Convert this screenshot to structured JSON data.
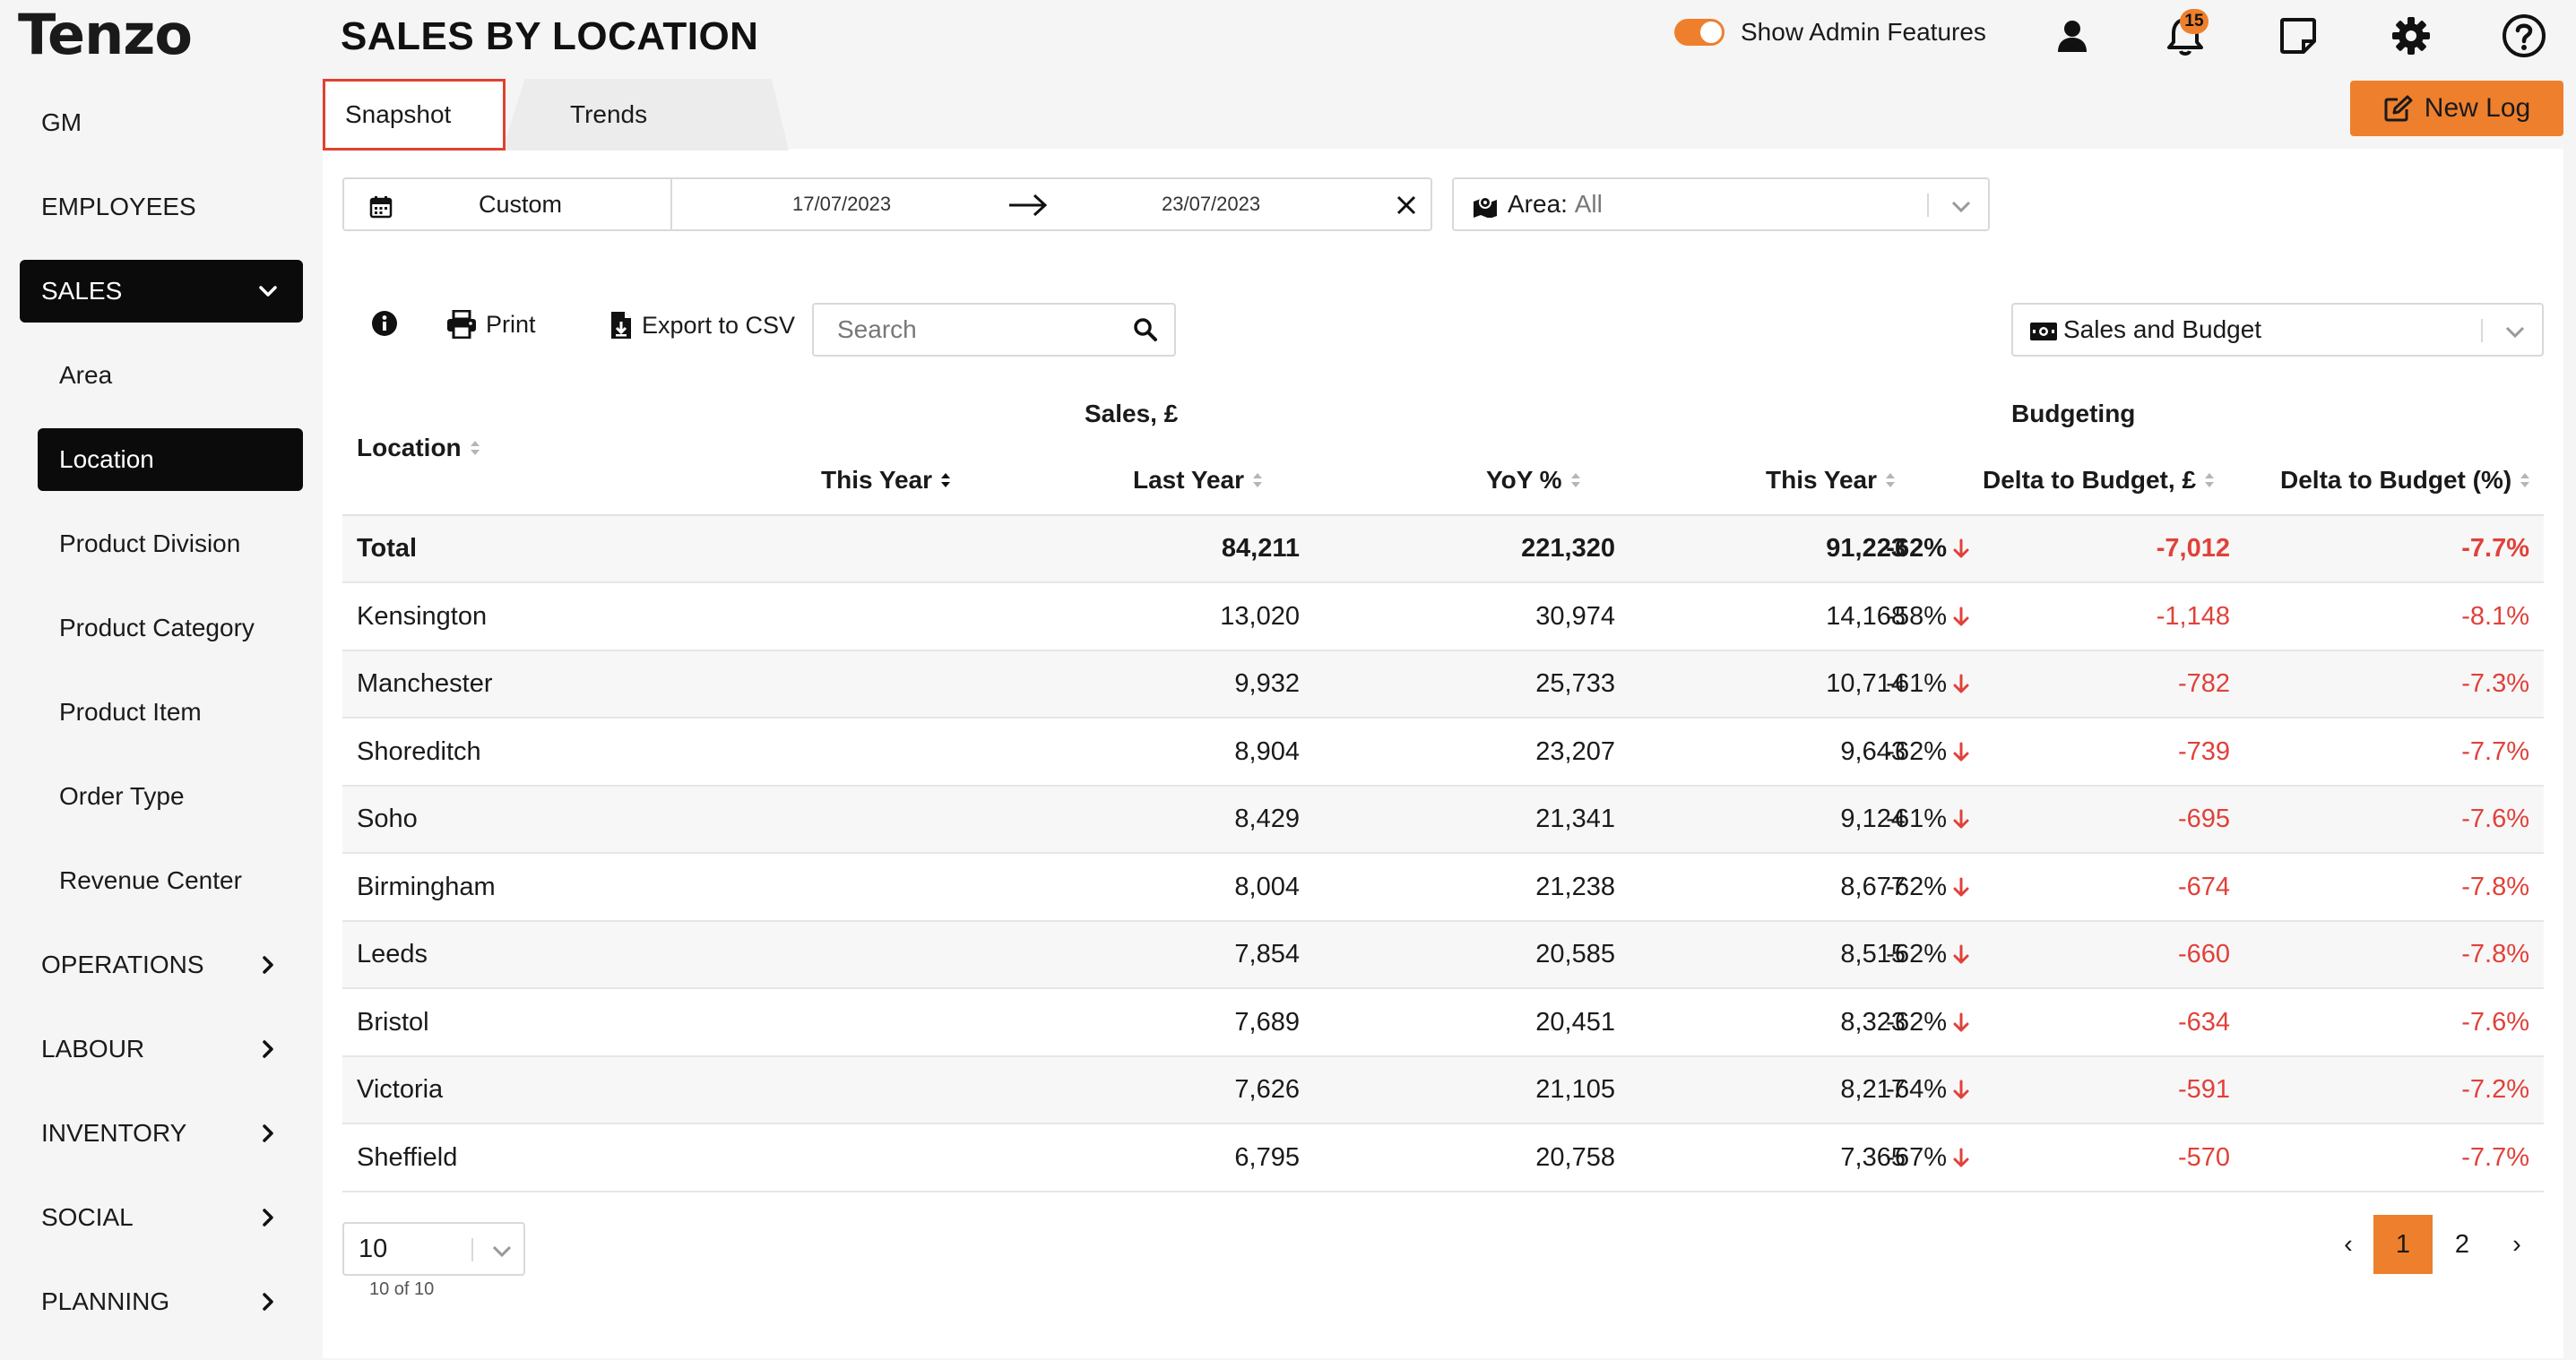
{
  "app": {
    "logo": "Tenzo"
  },
  "header": {
    "title": "SALES BY LOCATION",
    "admin_toggle_label": "Show Admin Features",
    "admin_toggle_on": true,
    "notification_count": "15",
    "new_log_label": "New Log"
  },
  "sidebar": {
    "items": [
      {
        "label": "GM"
      },
      {
        "label": "EMPLOYEES"
      },
      {
        "label": "SALES",
        "expanded": true
      },
      {
        "label": "OPERATIONS"
      },
      {
        "label": "LABOUR"
      },
      {
        "label": "INVENTORY"
      },
      {
        "label": "SOCIAL"
      },
      {
        "label": "PLANNING"
      }
    ],
    "sales_sub": [
      {
        "label": "Area"
      },
      {
        "label": "Location",
        "active": true
      },
      {
        "label": "Product Division"
      },
      {
        "label": "Product Category"
      },
      {
        "label": "Product Item"
      },
      {
        "label": "Order Type"
      },
      {
        "label": "Revenue Center"
      }
    ]
  },
  "tabs": [
    {
      "label": "Snapshot",
      "active": true
    },
    {
      "label": "Trends"
    }
  ],
  "filters": {
    "date_preset": "Custom",
    "start_date": "17/07/2023",
    "end_date": "23/07/2023",
    "area_label": "Area:",
    "area_value": "All"
  },
  "toolbar": {
    "print_label": "Print",
    "export_label": "Export to CSV",
    "search_placeholder": "Search",
    "metric_select": "Sales and Budget"
  },
  "table": {
    "group_sales": "Sales, £",
    "group_budget": "Budgeting",
    "columns": {
      "location": "Location",
      "this_year": "This Year",
      "last_year": "Last Year",
      "yoy": "YoY %",
      "budget_this_year": "This Year",
      "delta_budget": "Delta to Budget, £",
      "delta_budget_pct": "Delta to Budget (%)"
    },
    "total": {
      "location": "Total",
      "this_year": "84,211",
      "last_year": "221,320",
      "yoy": "-62%",
      "budget": "91,223",
      "delta": "-7,012",
      "delta_pct": "-7.7%"
    },
    "rows": [
      {
        "location": "Kensington",
        "this_year": "13,020",
        "last_year": "30,974",
        "yoy": "-58%",
        "budget": "14,168",
        "delta": "-1,148",
        "delta_pct": "-8.1%"
      },
      {
        "location": "Manchester",
        "this_year": "9,932",
        "last_year": "25,733",
        "yoy": "-61%",
        "budget": "10,714",
        "delta": "-782",
        "delta_pct": "-7.3%"
      },
      {
        "location": "Shoreditch",
        "this_year": "8,904",
        "last_year": "23,207",
        "yoy": "-62%",
        "budget": "9,643",
        "delta": "-739",
        "delta_pct": "-7.7%"
      },
      {
        "location": "Soho",
        "this_year": "8,429",
        "last_year": "21,341",
        "yoy": "-61%",
        "budget": "9,124",
        "delta": "-695",
        "delta_pct": "-7.6%"
      },
      {
        "location": "Birmingham",
        "this_year": "8,004",
        "last_year": "21,238",
        "yoy": "-62%",
        "budget": "8,677",
        "delta": "-674",
        "delta_pct": "-7.8%"
      },
      {
        "location": "Leeds",
        "this_year": "7,854",
        "last_year": "20,585",
        "yoy": "-62%",
        "budget": "8,515",
        "delta": "-660",
        "delta_pct": "-7.8%"
      },
      {
        "location": "Bristol",
        "this_year": "7,689",
        "last_year": "20,451",
        "yoy": "-62%",
        "budget": "8,323",
        "delta": "-634",
        "delta_pct": "-7.6%"
      },
      {
        "location": "Victoria",
        "this_year": "7,626",
        "last_year": "21,105",
        "yoy": "-64%",
        "budget": "8,217",
        "delta": "-591",
        "delta_pct": "-7.2%"
      },
      {
        "location": "Sheffield",
        "this_year": "6,795",
        "last_year": "20,758",
        "yoy": "-67%",
        "budget": "7,365",
        "delta": "-570",
        "delta_pct": "-7.7%"
      }
    ]
  },
  "footer": {
    "page_size": "10",
    "count_text": "10 of 10",
    "prev": "‹",
    "next": "›",
    "pages": [
      "1",
      "2"
    ],
    "current_page": "1"
  },
  "colors": {
    "accent": "#ee7f2d",
    "negative": "#e0413a",
    "nav_active_bg": "#0b0b0b",
    "tab_highlight": "#e0412f"
  },
  "icons": {
    "calendar": "calendar-icon",
    "arrow": "arrow-right-icon",
    "clear": "close-icon",
    "area": "map-icon",
    "info": "info-icon",
    "print": "printer-icon",
    "export": "file-download-icon",
    "search": "search-icon",
    "metric": "money-icon",
    "user": "user-icon",
    "bell": "bell-icon",
    "note": "note-icon",
    "settings": "gear-icon",
    "help": "help-icon",
    "edit": "edit-icon"
  }
}
